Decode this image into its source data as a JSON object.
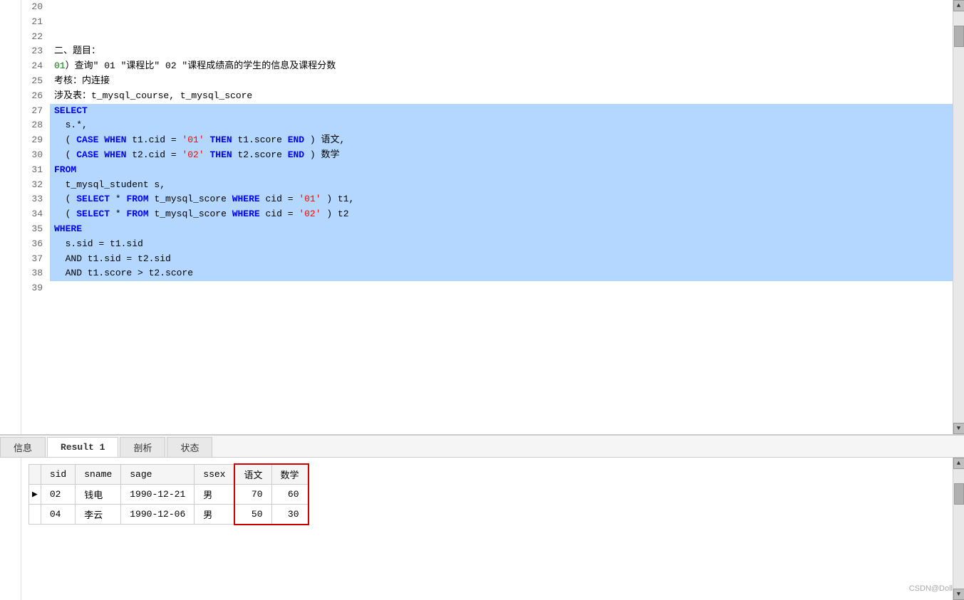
{
  "editor": {
    "lines": [
      {
        "num": "20",
        "text": "",
        "selected": false,
        "tokens": []
      },
      {
        "num": "21",
        "text": "",
        "selected": false,
        "tokens": []
      },
      {
        "num": "22",
        "text": "",
        "selected": false,
        "tokens": []
      },
      {
        "num": "23",
        "text": "二、题目：",
        "selected": false,
        "tokens": [
          {
            "type": "black",
            "text": "二、题目："
          }
        ]
      },
      {
        "num": "24",
        "text": "01）查询\" 01 \"课程比\" 02 \"课程成绩高的学生的信息及课程分数",
        "selected": false,
        "tokens": [
          {
            "type": "green",
            "text": "01"
          },
          {
            "type": "black",
            "text": "）查询\" 01 \"课程比\" 02 \"课程成绩高的学生的信息及课程分数"
          }
        ]
      },
      {
        "num": "25",
        "text": "考核：内连接",
        "selected": false,
        "tokens": [
          {
            "type": "black",
            "text": "考核：内连接"
          }
        ]
      },
      {
        "num": "26",
        "text": "涉及表：t_mysql_course, t_mysql_score",
        "selected": false,
        "tokens": [
          {
            "type": "black",
            "text": "涉及表：t_mysql_course, t_mysql_score"
          }
        ]
      },
      {
        "num": "27",
        "text": "SELECT",
        "selected": true,
        "tokens": [
          {
            "type": "blue",
            "text": "SELECT"
          }
        ]
      },
      {
        "num": "28",
        "text": "  s.*,",
        "selected": true,
        "tokens": [
          {
            "type": "black",
            "text": "  s.*,"
          }
        ]
      },
      {
        "num": "29",
        "text": "  ( CASE WHEN t1.cid = '01' THEN t1.score END ) 语文,",
        "selected": true,
        "tokens": [
          {
            "type": "black",
            "text": "  ( "
          },
          {
            "type": "blue",
            "text": "CASE WHEN"
          },
          {
            "type": "black",
            "text": " t1.cid = "
          },
          {
            "type": "red",
            "text": "'01'"
          },
          {
            "type": "blue",
            "text": " THEN"
          },
          {
            "type": "black",
            "text": " t1.score "
          },
          {
            "type": "blue",
            "text": "END"
          },
          {
            "type": "black",
            "text": " ) 语文,"
          }
        ]
      },
      {
        "num": "30",
        "text": "  ( CASE WHEN t2.cid = '02' THEN t2.score END ) 数学",
        "selected": true,
        "tokens": [
          {
            "type": "black",
            "text": "  ( "
          },
          {
            "type": "blue",
            "text": "CASE WHEN"
          },
          {
            "type": "black",
            "text": " t2.cid = "
          },
          {
            "type": "red",
            "text": "'02'"
          },
          {
            "type": "blue",
            "text": " THEN"
          },
          {
            "type": "black",
            "text": " t2.score "
          },
          {
            "type": "blue",
            "text": "END"
          },
          {
            "type": "black",
            "text": " ) 数学"
          }
        ]
      },
      {
        "num": "31",
        "text": "FROM",
        "selected": true,
        "tokens": [
          {
            "type": "blue",
            "text": "FROM"
          }
        ]
      },
      {
        "num": "32",
        "text": "  t_mysql_student s,",
        "selected": true,
        "tokens": [
          {
            "type": "black",
            "text": "  t_mysql_student s,"
          }
        ]
      },
      {
        "num": "33",
        "text": "  ( SELECT * FROM t_mysql_score WHERE cid = '01' ) t1,",
        "selected": true,
        "tokens": [
          {
            "type": "black",
            "text": "  ( "
          },
          {
            "type": "blue",
            "text": "SELECT"
          },
          {
            "type": "black",
            "text": " * "
          },
          {
            "type": "blue",
            "text": "FROM"
          },
          {
            "type": "black",
            "text": " t_mysql_score "
          },
          {
            "type": "blue",
            "text": "WHERE"
          },
          {
            "type": "black",
            "text": " cid = "
          },
          {
            "type": "red",
            "text": "'01'"
          },
          {
            "type": "black",
            "text": " ) t1,"
          }
        ]
      },
      {
        "num": "34",
        "text": "  ( SELECT * FROM t_mysql_score WHERE cid = '02' ) t2",
        "selected": true,
        "tokens": [
          {
            "type": "black",
            "text": "  ( "
          },
          {
            "type": "blue",
            "text": "SELECT"
          },
          {
            "type": "black",
            "text": " * "
          },
          {
            "type": "blue",
            "text": "FROM"
          },
          {
            "type": "black",
            "text": " t_mysql_score "
          },
          {
            "type": "blue",
            "text": "WHERE"
          },
          {
            "type": "black",
            "text": " cid = "
          },
          {
            "type": "red",
            "text": "'02'"
          },
          {
            "type": "black",
            "text": " ) t2"
          }
        ]
      },
      {
        "num": "35",
        "text": "WHERE",
        "selected": true,
        "tokens": [
          {
            "type": "blue",
            "text": "WHERE"
          }
        ]
      },
      {
        "num": "36",
        "text": "  s.sid = t1.sid",
        "selected": true,
        "tokens": [
          {
            "type": "black",
            "text": "  s.sid = t1.sid"
          }
        ]
      },
      {
        "num": "37",
        "text": "  AND t1.sid = t2.sid",
        "selected": true,
        "tokens": [
          {
            "type": "black",
            "text": "  AND t1.sid = t2.sid"
          }
        ]
      },
      {
        "num": "38",
        "text": "  AND t1.score > t2.score",
        "selected": true,
        "tokens": [
          {
            "type": "black",
            "text": "  AND t1.score > t2.score"
          }
        ]
      },
      {
        "num": "39",
        "text": "",
        "selected": false,
        "tokens": []
      }
    ]
  },
  "tabs": [
    {
      "label": "信息",
      "active": false
    },
    {
      "label": "Result 1",
      "active": true
    },
    {
      "label": "剖析",
      "active": false
    },
    {
      "label": "状态",
      "active": false
    }
  ],
  "results": {
    "columns": [
      "sid",
      "sname",
      "sage",
      "ssex",
      "语文",
      "数学"
    ],
    "rows": [
      {
        "arrow": true,
        "sid": "02",
        "sname": "钱电",
        "sage": "1990-12-21",
        "ssex": "男",
        "yuwen": "70",
        "shuxue": "60"
      },
      {
        "arrow": false,
        "sid": "04",
        "sname": "李云",
        "sage": "1990-12-06",
        "ssex": "男",
        "yuwen": "50",
        "shuxue": "30"
      }
    ]
  },
  "watermark": "CSDN@Doll"
}
